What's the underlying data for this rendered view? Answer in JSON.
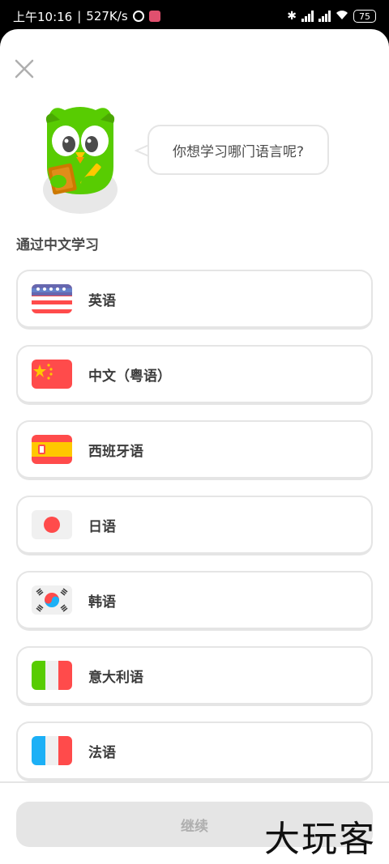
{
  "status_bar": {
    "time": "上午10:16",
    "net_speed": "527K/s",
    "battery": "75"
  },
  "icons": {
    "close": "close-icon",
    "mascot": "duo-owl-mascot"
  },
  "colors": {
    "border": "#e5e5e5",
    "text_primary": "#3c3c3c",
    "button_disabled_bg": "#e5e5e5",
    "button_disabled_text": "#afafaf"
  },
  "speech_bubble": "你想学习哪门语言呢?",
  "section_title": "通过中文学习",
  "languages": [
    {
      "label": "英语",
      "flag": "us-flag"
    },
    {
      "label": "中文（粤语）",
      "flag": "china-flag"
    },
    {
      "label": "西班牙语",
      "flag": "spain-flag"
    },
    {
      "label": "日语",
      "flag": "japan-flag"
    },
    {
      "label": "韩语",
      "flag": "korea-flag"
    },
    {
      "label": "意大利语",
      "flag": "italy-flag"
    },
    {
      "label": "法语",
      "flag": "france-flag"
    }
  ],
  "continue_label": "继续",
  "watermark": "大玩客"
}
